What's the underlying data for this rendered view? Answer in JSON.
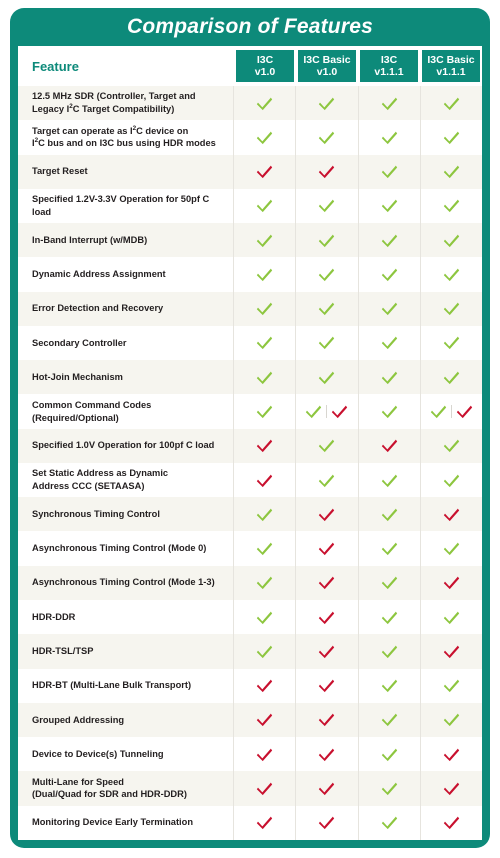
{
  "title": "Comparison of Features",
  "colors": {
    "brand_teal": "#0d8a7a",
    "yes_green": "#8dc63f",
    "no_red": "#c8102e",
    "row_alt": "#f6f5ef",
    "row_base": "#ffffff",
    "text": "#231f20"
  },
  "header": {
    "feature_label": "Feature",
    "columns": [
      {
        "line1": "I3C",
        "line2": "v1.0"
      },
      {
        "line1": "I3C Basic",
        "line2": "v1.0"
      },
      {
        "line1": "I3C",
        "line2": "v1.1.1"
      },
      {
        "line1": "I3C Basic",
        "line2": "v1.1.1"
      }
    ]
  },
  "legend": {
    "yes_icon": "green-check-icon",
    "no_icon": "red-check-icon"
  },
  "rows": [
    {
      "lines": [
        "12.5 MHz SDR (Controller, Target and",
        "Legacy I²C Target Compatibility)"
      ],
      "marks": [
        "yes",
        "yes",
        "yes",
        "yes"
      ]
    },
    {
      "lines": [
        "Target can operate as I²C device on",
        "I²C bus and on I3C bus using HDR modes"
      ],
      "marks": [
        "yes",
        "yes",
        "yes",
        "yes"
      ]
    },
    {
      "lines": [
        "Target Reset"
      ],
      "marks": [
        "no",
        "no",
        "yes",
        "yes"
      ]
    },
    {
      "lines": [
        "Specified 1.2V-3.3V Operation for 50pf C load"
      ],
      "marks": [
        "yes",
        "yes",
        "yes",
        "yes"
      ]
    },
    {
      "lines": [
        "In-Band Interrupt (w/MDB)"
      ],
      "marks": [
        "yes",
        "yes",
        "yes",
        "yes"
      ]
    },
    {
      "lines": [
        "Dynamic Address Assignment"
      ],
      "marks": [
        "yes",
        "yes",
        "yes",
        "yes"
      ]
    },
    {
      "lines": [
        "Error Detection and Recovery"
      ],
      "marks": [
        "yes",
        "yes",
        "yes",
        "yes"
      ]
    },
    {
      "lines": [
        "Secondary Controller"
      ],
      "marks": [
        "yes",
        "yes",
        "yes",
        "yes"
      ]
    },
    {
      "lines": [
        "Hot-Join Mechanism"
      ],
      "marks": [
        "yes",
        "yes",
        "yes",
        "yes"
      ]
    },
    {
      "lines": [
        "Common Command Codes",
        "(Required/Optional)"
      ],
      "marks": [
        "yes",
        "yes+no",
        "yes",
        "yes+no"
      ]
    },
    {
      "lines": [
        "Specified 1.0V Operation for 100pf C load"
      ],
      "marks": [
        "no",
        "yes",
        "no",
        "yes"
      ]
    },
    {
      "lines": [
        "Set Static Address as Dynamic",
        "Address CCC (SETAASA)"
      ],
      "marks": [
        "no",
        "yes",
        "yes",
        "yes"
      ]
    },
    {
      "lines": [
        "Synchronous Timing Control"
      ],
      "marks": [
        "yes",
        "no",
        "yes",
        "no"
      ]
    },
    {
      "lines": [
        "Asynchronous Timing Control (Mode 0)"
      ],
      "marks": [
        "yes",
        "no",
        "yes",
        "yes"
      ]
    },
    {
      "lines": [
        "Asynchronous Timing Control (Mode 1-3)"
      ],
      "marks": [
        "yes",
        "no",
        "yes",
        "no"
      ]
    },
    {
      "lines": [
        "HDR-DDR"
      ],
      "marks": [
        "yes",
        "no",
        "yes",
        "yes"
      ]
    },
    {
      "lines": [
        "HDR-TSL/TSP"
      ],
      "marks": [
        "yes",
        "no",
        "yes",
        "no"
      ]
    },
    {
      "lines": [
        "HDR-BT (Multi-Lane Bulk Transport)"
      ],
      "marks": [
        "no",
        "no",
        "yes",
        "yes"
      ]
    },
    {
      "lines": [
        "Grouped Addressing"
      ],
      "marks": [
        "no",
        "no",
        "yes",
        "yes"
      ]
    },
    {
      "lines": [
        "Device to Device(s) Tunneling"
      ],
      "marks": [
        "no",
        "no",
        "yes",
        "no"
      ]
    },
    {
      "lines": [
        "Multi-Lane for Speed",
        "(Dual/Quad for SDR and HDR-DDR)"
      ],
      "marks": [
        "no",
        "no",
        "yes",
        "no"
      ]
    },
    {
      "lines": [
        "Monitoring Device Early Termination"
      ],
      "marks": [
        "no",
        "no",
        "yes",
        "no"
      ]
    }
  ]
}
